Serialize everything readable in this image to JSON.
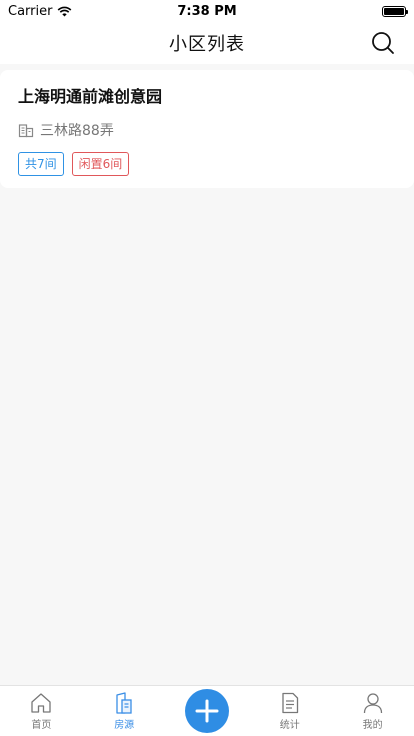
{
  "status_bar": {
    "carrier": "Carrier",
    "time": "7:38 PM"
  },
  "nav": {
    "title": "小区列表",
    "search_icon": "search-icon"
  },
  "community_card": {
    "name": "上海明通前滩创意园",
    "address": "三林路88弄",
    "tag_total": "共7间",
    "tag_idle": "闲置6间",
    "colors": {
      "blue": "#2f92e4",
      "red": "#e0575a"
    }
  },
  "tab_bar": {
    "home_label": "首页",
    "listings_label": "房源",
    "stats_label": "统计",
    "mine_label": "我的",
    "active_color": "#3a8ee6",
    "fab_color": "#2f8de4"
  }
}
